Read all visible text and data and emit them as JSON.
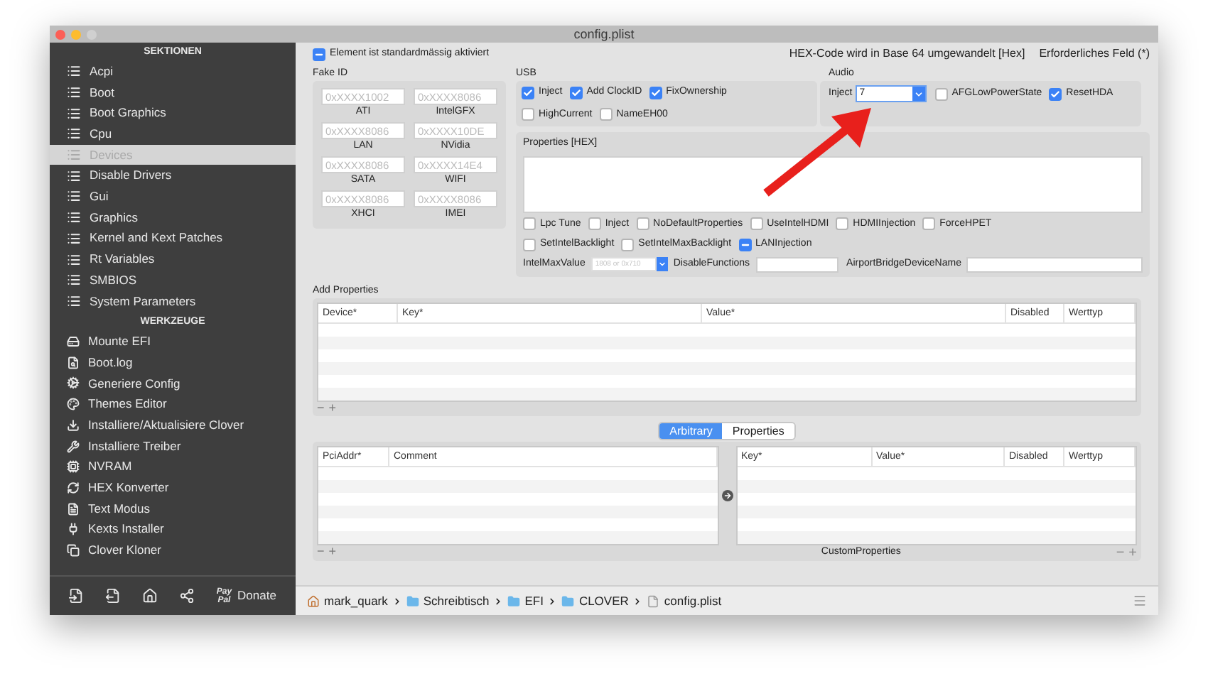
{
  "window": {
    "title": "config.plist"
  },
  "sidebar": {
    "sections_heading": "SEKTIONEN",
    "sections": [
      {
        "label": "Acpi",
        "selected": false
      },
      {
        "label": "Boot",
        "selected": false
      },
      {
        "label": "Boot Graphics",
        "selected": false
      },
      {
        "label": "Cpu",
        "selected": false
      },
      {
        "label": "Devices",
        "selected": true
      },
      {
        "label": "Disable Drivers",
        "selected": false
      },
      {
        "label": "Gui",
        "selected": false
      },
      {
        "label": "Graphics",
        "selected": false
      },
      {
        "label": "Kernel and Kext Patches",
        "selected": false
      },
      {
        "label": "Rt Variables",
        "selected": false
      },
      {
        "label": "SMBIOS",
        "selected": false
      },
      {
        "label": "System Parameters",
        "selected": false
      }
    ],
    "tools_heading": "WERKZEUGE",
    "tools": [
      {
        "label": "Mounte EFI"
      },
      {
        "label": "Boot.log"
      },
      {
        "label": "Generiere Config"
      },
      {
        "label": "Themes Editor"
      },
      {
        "label": "Installiere/Aktualisiere Clover"
      },
      {
        "label": "Installiere Treiber"
      },
      {
        "label": "NVRAM"
      },
      {
        "label": "HEX Konverter"
      },
      {
        "label": "Text Modus"
      },
      {
        "label": "Kexts Installer"
      },
      {
        "label": "Clover Kloner"
      }
    ],
    "donate": {
      "logo_lines": [
        "Pay",
        "Pal"
      ],
      "label": "Donate"
    }
  },
  "header": {
    "default_checkbox": {
      "label": "Element ist standardmässig aktiviert",
      "checked": true,
      "mixed": true
    },
    "hex_note": "HEX-Code wird in Base 64 umgewandelt [Hex]",
    "required_note": "Erforderliches Feld (*)"
  },
  "fake_id": {
    "title": "Fake ID",
    "fields": [
      {
        "placeholder": "0xXXXX1002",
        "label": "ATI"
      },
      {
        "placeholder": "0xXXXX8086",
        "label": "IntelGFX"
      },
      {
        "placeholder": "0xXXXX8086",
        "label": "LAN"
      },
      {
        "placeholder": "0xXXXX10DE",
        "label": "NVidia"
      },
      {
        "placeholder": "0xXXXX8086",
        "label": "SATA"
      },
      {
        "placeholder": "0xXXXX14E4",
        "label": "WIFI"
      },
      {
        "placeholder": "0xXXXX8086",
        "label": "XHCI"
      },
      {
        "placeholder": "0xXXXX8086",
        "label": "IMEI"
      }
    ]
  },
  "usb": {
    "title": "USB",
    "checkboxes": [
      {
        "label": "Inject",
        "checked": true
      },
      {
        "label": "Add ClockID",
        "checked": true
      },
      {
        "label": "FixOwnership",
        "checked": true
      },
      {
        "label": "HighCurrent",
        "checked": false
      },
      {
        "label": "NameEH00",
        "checked": false
      }
    ]
  },
  "audio": {
    "title": "Audio",
    "inject_label": "Inject",
    "inject_value": "7",
    "checkboxes": [
      {
        "label": "AFGLowPowerState",
        "checked": false
      },
      {
        "label": "ResetHDA",
        "checked": true
      }
    ]
  },
  "properties_hex": {
    "title": "Properties [HEX]"
  },
  "options": {
    "checkboxes": [
      {
        "label": "Lpc Tune",
        "checked": false
      },
      {
        "label": "Inject",
        "checked": false
      },
      {
        "label": "NoDefaultProperties",
        "checked": false
      },
      {
        "label": "UseIntelHDMI",
        "checked": false
      },
      {
        "label": "HDMIInjection",
        "checked": false
      },
      {
        "label": "ForceHPET",
        "checked": false
      },
      {
        "label": "SetIntelBacklight",
        "checked": false
      },
      {
        "label": "SetIntelMaxBacklight",
        "checked": false
      },
      {
        "label": "LANInjection",
        "checked": true,
        "mixed": true
      }
    ],
    "intel_max_value": {
      "label": "IntelMaxValue",
      "placeholder": "1808 or 0x710"
    },
    "disable_functions": {
      "label": "DisableFunctions"
    },
    "airport_bridge": {
      "label": "AirportBridgeDeviceName"
    }
  },
  "add_properties": {
    "title": "Add Properties",
    "columns": [
      "Device*",
      "Key*",
      "Value*",
      "Disabled",
      "Werttyp"
    ],
    "remove": "−",
    "add": "+"
  },
  "segmented": [
    {
      "label": "Arbitrary",
      "selected": true
    },
    {
      "label": "Properties",
      "selected": false
    }
  ],
  "arbitrary": {
    "left_columns": [
      "PciAddr*",
      "Comment"
    ],
    "right_columns": [
      "Key*",
      "Value*",
      "Disabled",
      "Werttyp"
    ],
    "left_remove": "−",
    "left_add": "+",
    "caption": "CustomProperties",
    "right_remove": "−",
    "right_add": "+"
  },
  "path_bar": [
    {
      "label": "mark_quark",
      "kind": "home"
    },
    {
      "label": "Schreibtisch",
      "kind": "folder"
    },
    {
      "label": "EFI",
      "kind": "folder"
    },
    {
      "label": "CLOVER",
      "kind": "folder"
    },
    {
      "label": "config.plist",
      "kind": "file"
    }
  ]
}
